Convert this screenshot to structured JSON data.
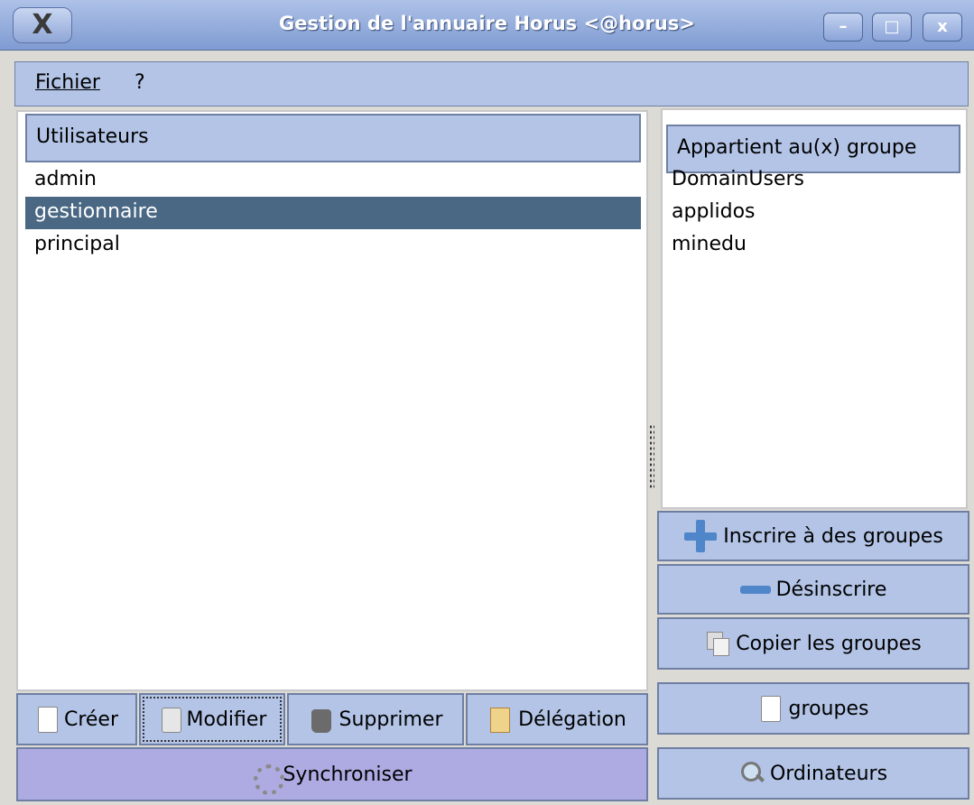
{
  "window": {
    "title": "Gestion de l'annuaire Horus <@horus>",
    "logo": "X",
    "controls": {
      "minimize": "–",
      "maximize": "□",
      "close": "x"
    }
  },
  "menu": {
    "items": [
      "Fichier",
      "?"
    ]
  },
  "users_panel": {
    "header": "Utilisateurs",
    "rows": [
      "admin",
      "gestionnaire",
      "principal"
    ],
    "selected": "gestionnaire"
  },
  "groups_panel": {
    "header": "Appartient au(x) groupe",
    "rows": [
      "DomainUsers",
      "applidos",
      "minedu"
    ]
  },
  "user_actions": {
    "create": "Créer",
    "modify": "Modifier",
    "delete": "Supprimer",
    "delegation": "Délégation",
    "sync": "Synchroniser"
  },
  "group_actions": {
    "subscribe": "Inscrire à des groupes",
    "unsubscribe": "Désinscrire",
    "copy": "Copier les groupes",
    "groups": "groupes",
    "computers": "Ordinateurs"
  },
  "colors": {
    "panel": "#b3c4e6",
    "selection": "#4a6884",
    "sync_button": "#aeabe3"
  }
}
